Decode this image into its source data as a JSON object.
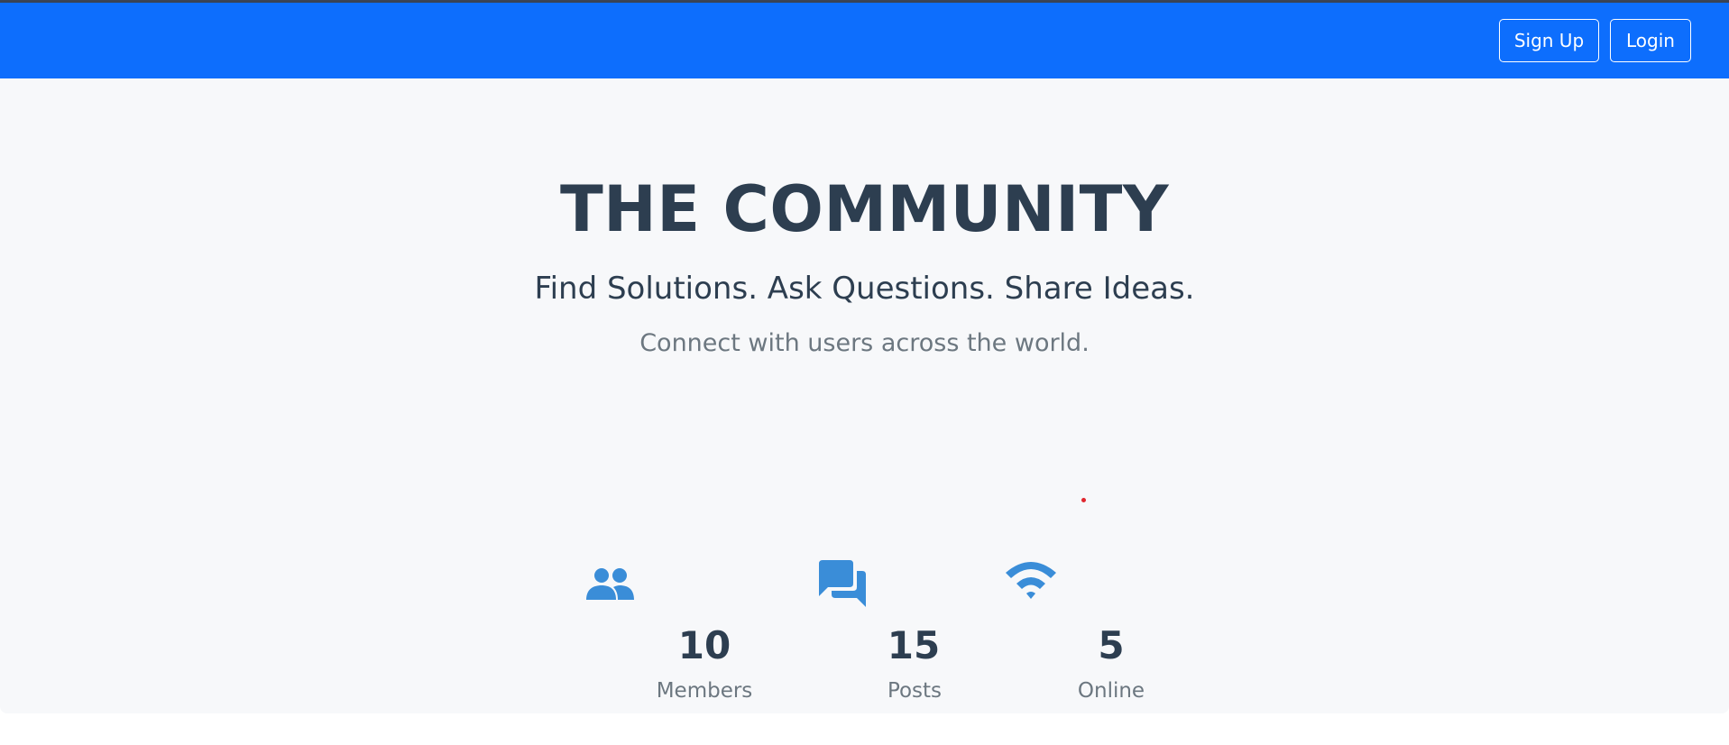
{
  "nav": {
    "signup_label": "Sign Up",
    "login_label": "Login",
    "bg_color": "#0d6efd"
  },
  "hero": {
    "title": "THE COMMUNITY",
    "tagline": "Find Solutions. Ask Questions. Share Ideas.",
    "subtitle": "Connect with users across the world."
  },
  "stats": {
    "members": {
      "value": "10",
      "label": "Members",
      "icon": "people-icon"
    },
    "posts": {
      "value": "15",
      "label": "Posts",
      "icon": "chat-bubbles-icon"
    },
    "online": {
      "value": "5",
      "label": "Online",
      "icon": "wifi-icon"
    }
  },
  "colors": {
    "accent": "#3a8dd8",
    "heading": "#2d3e50",
    "muted": "#6c7780",
    "hero_bg": "#f7f8fa"
  }
}
